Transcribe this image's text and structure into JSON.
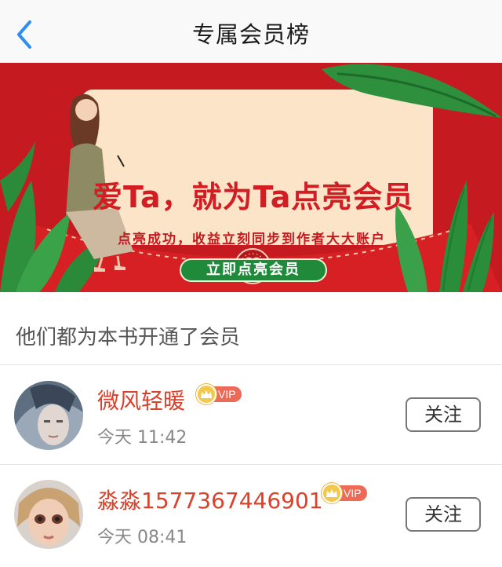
{
  "header": {
    "title": "专属会员榜"
  },
  "banner": {
    "headline": "爱Ta，就为Ta点亮会员",
    "subline": "点亮成功，收益立刻同步到作者大大账户",
    "cta_label": "立即点亮会员"
  },
  "section": {
    "heading": "他们都为本书开通了会员"
  },
  "members": [
    {
      "name": "微风轻暖",
      "badge": "VIP",
      "time": "今天 11:42",
      "follow_label": "关注"
    },
    {
      "name": "淼淼15773674469​01",
      "badge": "VIP",
      "time": "今天 08:41",
      "follow_label": "关注"
    }
  ],
  "colors": {
    "accent_blue": "#2f8ff0",
    "banner_red": "#c51a1f",
    "name_red": "#d9412a",
    "vip_red": "#ec6a57",
    "cta_green": "#1f8b3a"
  }
}
